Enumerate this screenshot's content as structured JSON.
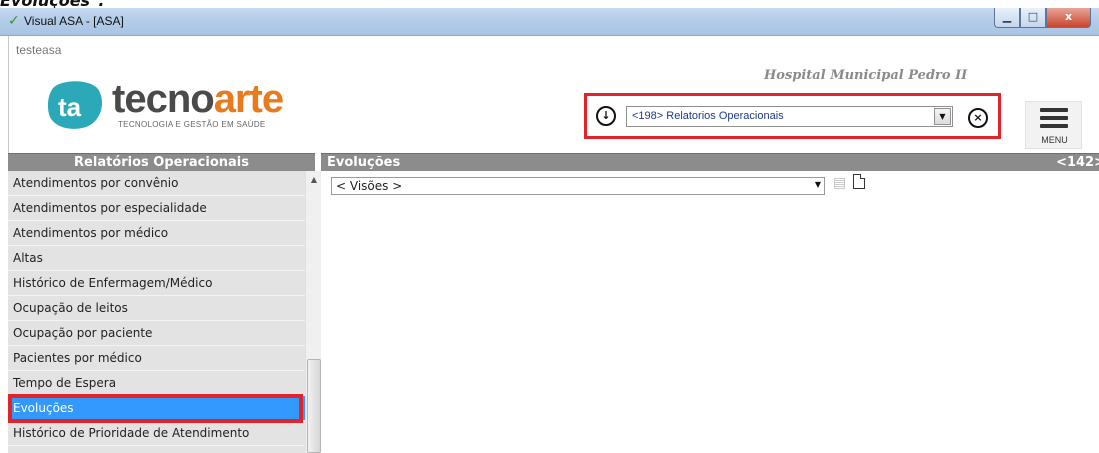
{
  "caption": "Evoluções\".",
  "window": {
    "title": "Visual ASA - [ASA]",
    "min_glyph": "▁",
    "max_glyph": "□",
    "close_glyph": "x"
  },
  "header": {
    "user": "testeasa",
    "logo": {
      "word_dark": "tecno",
      "word_accent": "arte",
      "tagline": "TECNOLOGIA E GESTÃO EM SAÚDE",
      "mark_text": "ta"
    },
    "hospital": "Hospital Municipal Pedro II",
    "report_select": {
      "value": "<198> Relatorios Operacionais"
    },
    "download_icon": "download-circle-icon",
    "close_icon": "close-circle-icon",
    "menu_label": "MENU"
  },
  "left_panel": {
    "title": "Relatórios Operacionais",
    "items": [
      {
        "label": "Atendimentos por convênio"
      },
      {
        "label": "Atendimentos por especialidade"
      },
      {
        "label": "Atendimentos por médico"
      },
      {
        "label": "Altas"
      },
      {
        "label": "Histórico de Enfermagem/Médico"
      },
      {
        "label": "Ocupação de leitos"
      },
      {
        "label": "Ocupação por paciente"
      },
      {
        "label": "Pacientes por médico"
      },
      {
        "label": "Tempo de Espera"
      },
      {
        "label": "Evoluções",
        "selected": true
      },
      {
        "label": "Histórico de Prioridade de Atendimento"
      }
    ]
  },
  "right_panel": {
    "title": "Evoluções",
    "code": "<142>",
    "visoes_select": {
      "value": "< Visões >"
    }
  },
  "colors": {
    "highlight_frame": "#e1242c",
    "selected_item": "#3399ff",
    "panel_header": "#8c8c8c",
    "logo_accent": "#e87b1e",
    "logo_mark": "#2ba9b8"
  }
}
